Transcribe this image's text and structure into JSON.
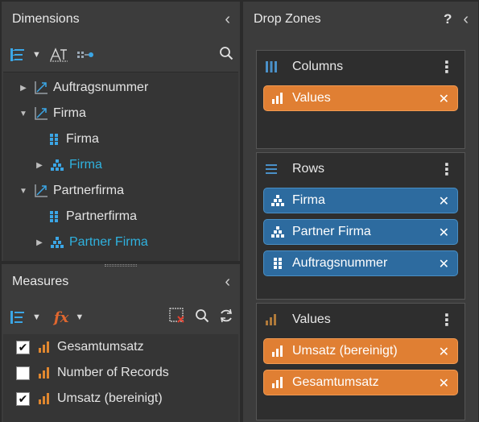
{
  "dimensions": {
    "title": "Dimensions",
    "tree": [
      {
        "label": "Auftragsnummer",
        "icon": "hierarchy-dimension-icon",
        "expanded": false
      },
      {
        "label": "Firma",
        "icon": "hierarchy-dimension-icon",
        "expanded": true
      },
      {
        "label": "Firma",
        "icon": "level-attribute-icon"
      },
      {
        "label": "Firma",
        "icon": "hierarchy-tree-icon",
        "expanded": false,
        "highlight": true
      },
      {
        "label": "Partnerfirma",
        "icon": "hierarchy-dimension-icon",
        "expanded": true
      },
      {
        "label": "Partnerfirma",
        "icon": "level-attribute-icon"
      },
      {
        "label": "Partner Firma",
        "icon": "hierarchy-tree-icon",
        "expanded": false,
        "highlight": true
      }
    ]
  },
  "measures": {
    "title": "Measures",
    "items": [
      {
        "label": "Gesamtumsatz",
        "checked": true
      },
      {
        "label": "Number of Records",
        "checked": false
      },
      {
        "label": "Umsatz (bereinigt)",
        "checked": true
      }
    ]
  },
  "dropzones": {
    "title": "Drop Zones",
    "help": "?",
    "columns": {
      "title": "Columns",
      "pills": [
        "Values"
      ]
    },
    "rows": {
      "title": "Rows",
      "pills": [
        "Firma",
        "Partner Firma",
        "Auftragsnummer"
      ]
    },
    "values": {
      "title": "Values",
      "pills": [
        "Umsatz (bereinigt)",
        "Gesamtumsatz"
      ]
    }
  },
  "colors": {
    "accent_blue": "#3ba6e6",
    "highlight_cyan": "#2fb2df",
    "pill_orange": "#e07f33",
    "pill_blue": "#2d6b9f"
  }
}
